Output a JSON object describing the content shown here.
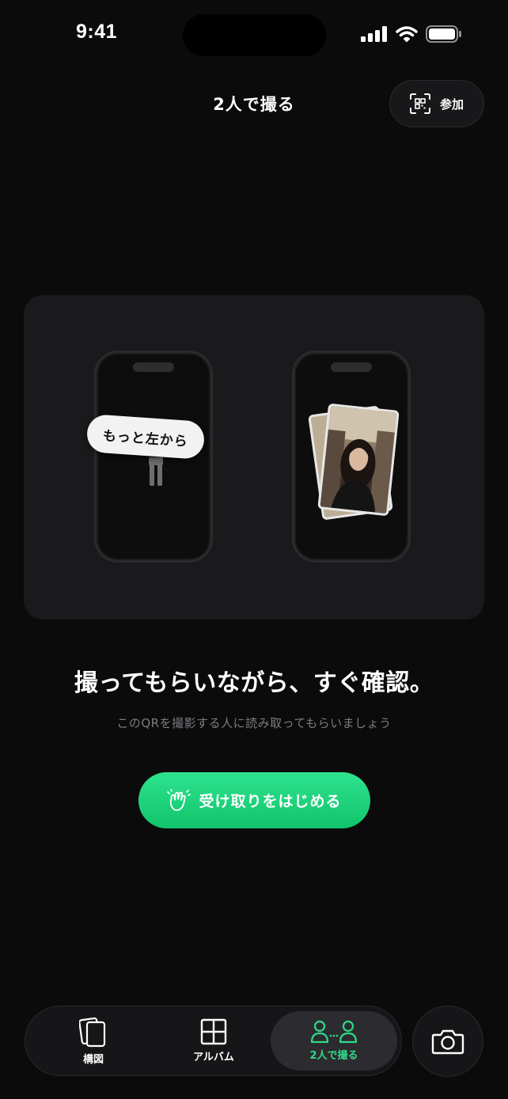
{
  "status_bar": {
    "time": "9:41"
  },
  "header": {
    "title": "2人で撮る",
    "join_label": "参加"
  },
  "illustration": {
    "bubble_text": "もっと左から"
  },
  "main": {
    "headline": "撮ってもらいながら、すぐ確認。",
    "subtext": "このQRを撮影する人に読み取ってもらいましょう",
    "cta_label": "受け取りをはじめる"
  },
  "tabbar": {
    "items": [
      {
        "label": "構図",
        "icon": "composition-icon",
        "selected": false
      },
      {
        "label": "アルバム",
        "icon": "grid-icon",
        "selected": false
      },
      {
        "label": "2人で撮る",
        "icon": "two-people-icon",
        "selected": true
      }
    ]
  },
  "colors": {
    "background": "#0b0b0c",
    "accent_green": "#2fd98a",
    "button_green": "#11c46b"
  }
}
